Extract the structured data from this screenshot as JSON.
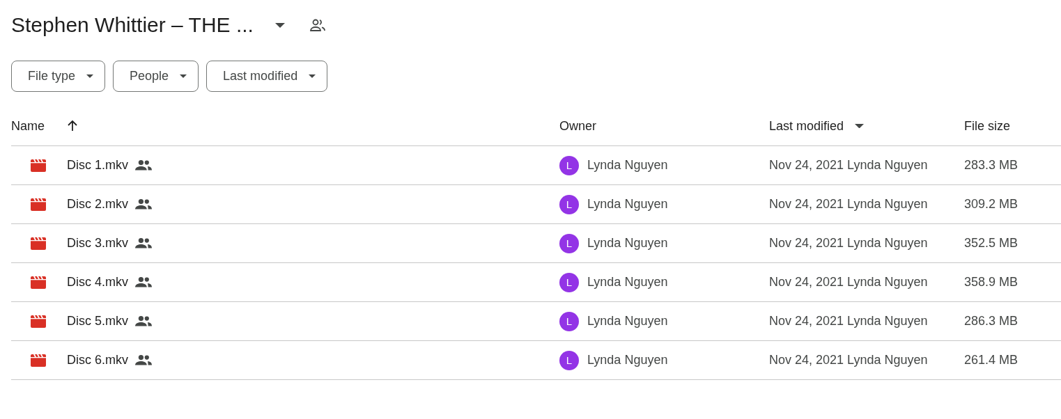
{
  "title": "Stephen Whittier – THE ...",
  "filters": [
    "File type",
    "People",
    "Last modified"
  ],
  "table": {
    "columns": [
      "Name",
      "Owner",
      "Last modified",
      "File size"
    ],
    "rows": [
      {
        "name": "Disc 1.mkv",
        "avatar_letter": "L",
        "owner": "Lynda Nguyen",
        "modified": "Nov 24, 2021 Lynda Nguyen",
        "size": "283.3 MB"
      },
      {
        "name": "Disc 2.mkv",
        "avatar_letter": "L",
        "owner": "Lynda Nguyen",
        "modified": "Nov 24, 2021 Lynda Nguyen",
        "size": "309.2 MB"
      },
      {
        "name": "Disc 3.mkv",
        "avatar_letter": "L",
        "owner": "Lynda Nguyen",
        "modified": "Nov 24, 2021 Lynda Nguyen",
        "size": "352.5 MB"
      },
      {
        "name": "Disc 4.mkv",
        "avatar_letter": "L",
        "owner": "Lynda Nguyen",
        "modified": "Nov 24, 2021 Lynda Nguyen",
        "size": "358.9 MB"
      },
      {
        "name": "Disc 5.mkv",
        "avatar_letter": "L",
        "owner": "Lynda Nguyen",
        "modified": "Nov 24, 2021 Lynda Nguyen",
        "size": "286.3 MB"
      },
      {
        "name": "Disc 6.mkv",
        "avatar_letter": "L",
        "owner": "Lynda Nguyen",
        "modified": "Nov 24, 2021 Lynda Nguyen",
        "size": "261.4 MB"
      }
    ]
  }
}
